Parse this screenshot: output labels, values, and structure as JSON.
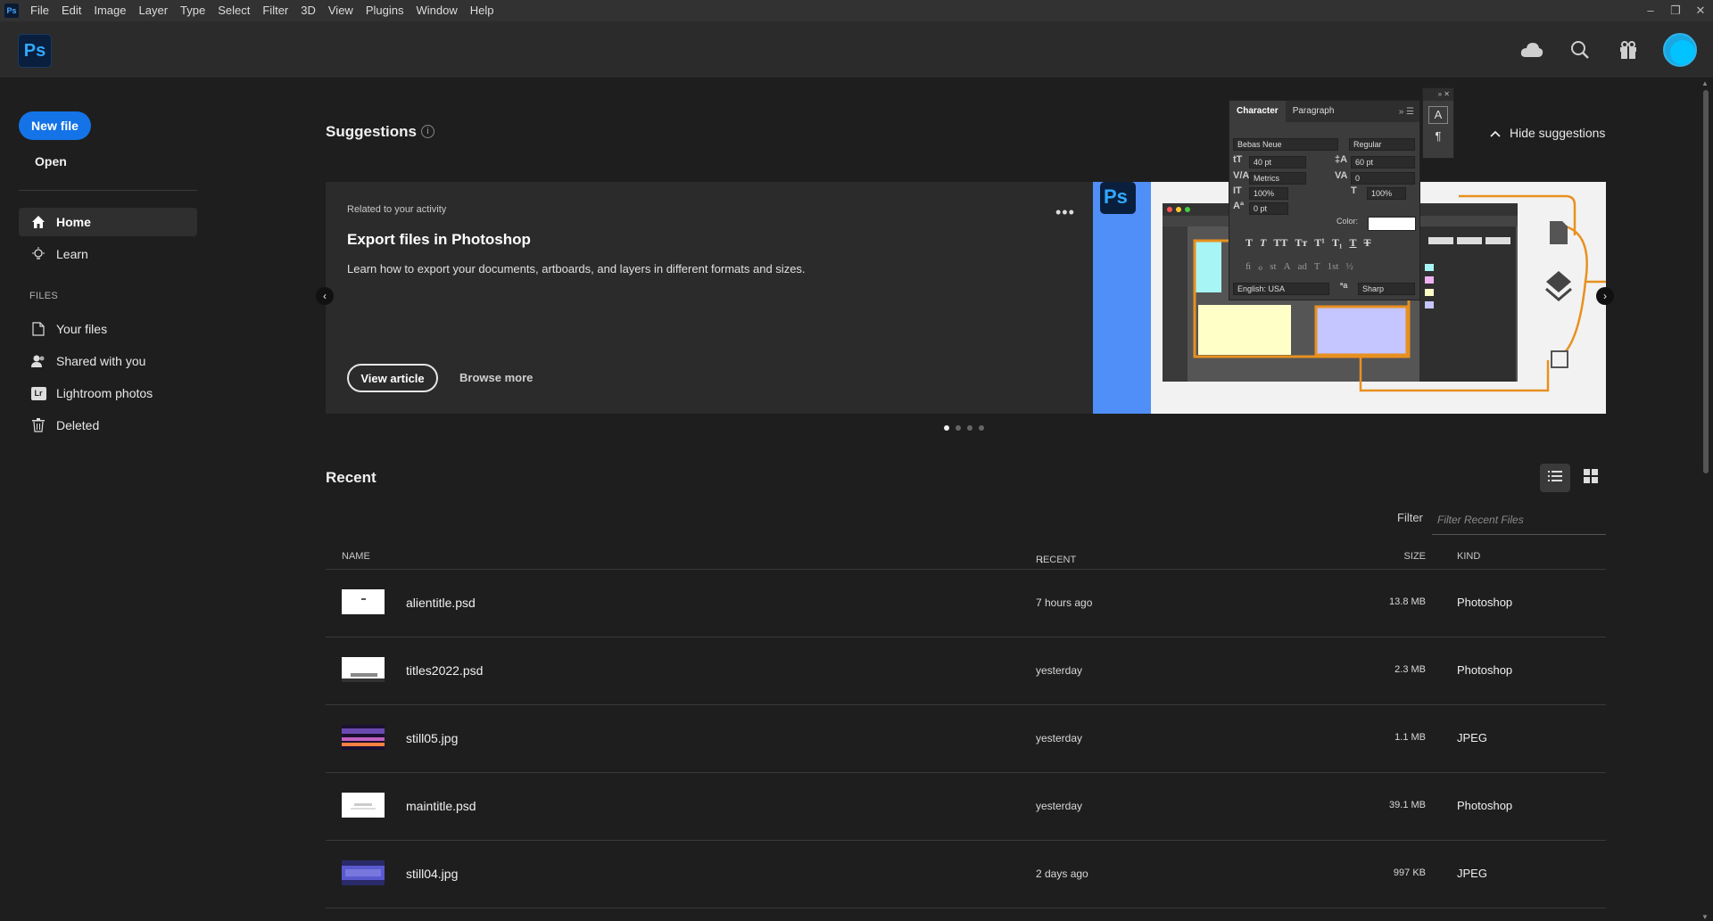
{
  "menubar": {
    "app_icon": "Ps",
    "items": [
      "File",
      "Edit",
      "Image",
      "Layer",
      "Type",
      "Select",
      "Filter",
      "3D",
      "View",
      "Plugins",
      "Window",
      "Help"
    ],
    "window_controls": [
      "–",
      "❐",
      "✕"
    ]
  },
  "header": {
    "app_badge": "Ps",
    "icons": [
      "cloud-icon",
      "search-icon",
      "gift-icon"
    ]
  },
  "sidebar": {
    "new_file": "New file",
    "open": "Open",
    "nav": [
      {
        "label": "Home",
        "icon": "home-icon",
        "active": true
      },
      {
        "label": "Learn",
        "icon": "lightbulb-icon",
        "active": false
      }
    ],
    "files_header": "FILES",
    "files": [
      {
        "label": "Your files",
        "icon": "file-icon"
      },
      {
        "label": "Shared with you",
        "icon": "people-icon"
      },
      {
        "label": "Lightroom photos",
        "icon": "lightroom-icon",
        "badge": "Lr"
      },
      {
        "label": "Deleted",
        "icon": "trash-icon"
      }
    ]
  },
  "suggestions": {
    "title": "Suggestions",
    "info": "i",
    "hide_label": "Hide suggestions",
    "card": {
      "related": "Related to your activity",
      "title": "Export files in Photoshop",
      "description": "Learn how to export your documents, artboards, and layers in different formats and sizes.",
      "more": "•••",
      "view_article": "View article",
      "browse_more": "Browse more",
      "image_badge": "Ps"
    },
    "carousel": {
      "prev": "‹",
      "next": "›",
      "pages": 4,
      "current": 1
    }
  },
  "character_panel": {
    "tabs": [
      "Character",
      "Paragraph"
    ],
    "font_family": "Bebas Neue",
    "font_style": "Regular",
    "font_size": "40 pt",
    "leading": "60 pt",
    "kerning": "Metrics",
    "tracking": "0",
    "vertical_scale": "100%",
    "horizontal_scale": "100%",
    "baseline_shift": "0 pt",
    "color_label": "Color:",
    "type_styles": [
      "T",
      "T",
      "TT",
      "Tт",
      "T¹",
      "T₁",
      "T",
      "T"
    ],
    "opentype": [
      "ﬁ",
      "ℴ",
      "st",
      "A",
      "ad",
      "T",
      "1st",
      "½"
    ],
    "language": "English: USA",
    "aa_label": "ªa",
    "antialias": "Sharp"
  },
  "recent": {
    "title": "Recent",
    "filter_label": "Filter",
    "filter_placeholder": "Filter Recent Files",
    "columns": {
      "name": "NAME",
      "recent": "RECENT",
      "sort_arrow": "↓",
      "size": "SIZE",
      "kind": "KIND"
    },
    "files": [
      {
        "name": "alientitle.psd",
        "recent": "7 hours ago",
        "size": "13.8 MB",
        "kind": "Photoshop",
        "thumb": "white"
      },
      {
        "name": "titles2022.psd",
        "recent": "yesterday",
        "size": "2.3 MB",
        "kind": "Photoshop",
        "thumb": "white-text"
      },
      {
        "name": "still05.jpg",
        "recent": "yesterday",
        "size": "1.1 MB",
        "kind": "JPEG",
        "thumb": "purple"
      },
      {
        "name": "maintitle.psd",
        "recent": "yesterday",
        "size": "39.1 MB",
        "kind": "Photoshop",
        "thumb": "white-faint"
      },
      {
        "name": "still04.jpg",
        "recent": "2 days ago",
        "size": "997 KB",
        "kind": "JPEG",
        "thumb": "blue-dots"
      }
    ]
  },
  "colors": {
    "accent": "#1473e6",
    "ps_blue": "#31a8ff",
    "avatar": "#00c3ff",
    "orange_lines": "#e8901f"
  }
}
